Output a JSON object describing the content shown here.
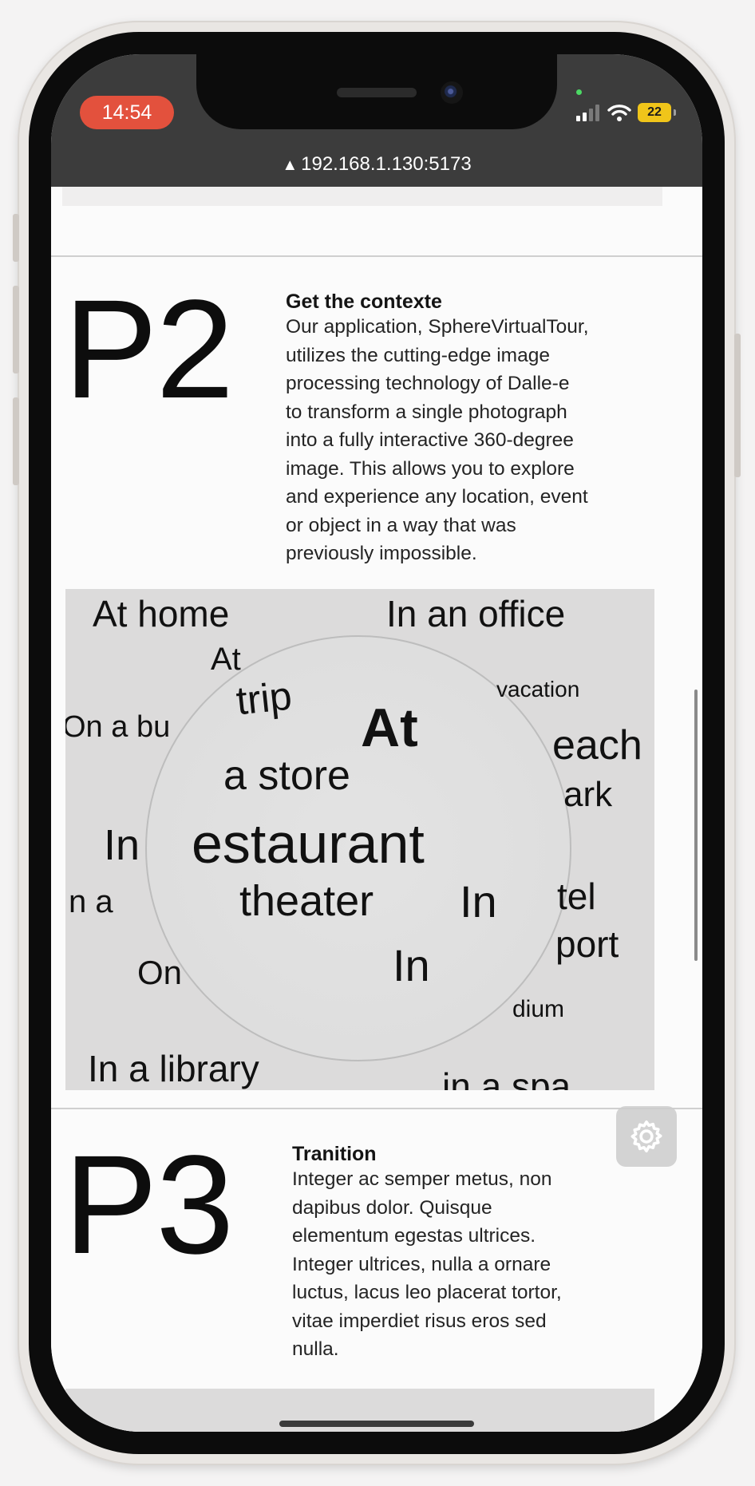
{
  "status_bar": {
    "time": "14:54",
    "battery": "22",
    "icons": [
      "signal-icon",
      "wifi-icon",
      "battery-icon"
    ]
  },
  "browser": {
    "url": "192.168.1.130:5173",
    "lock_icon": "▲"
  },
  "sections": [
    {
      "number": "P2",
      "title": "Get the contexte",
      "lines": [
        "Our application, SphereVirtualTour,",
        "utilizes the cutting-edge image",
        "processing technology of Dalle-e",
        "to transform a single photograph",
        "into a fully interactive 360-degree",
        "image. This allows you to explore",
        "and experience any location, event",
        "or object in a way that was",
        "previously impossible."
      ]
    },
    {
      "number": "P3",
      "title": "Tranition",
      "lines": [
        "Integer ac semper metus, non",
        "dapibus dolor. Quisque",
        "elementum egestas ultrices.",
        "Integer ultrices, nulla a ornare",
        "luctus, lacus leo placerat tortor,",
        "vitae imperdiet risus eros sed",
        "nulla."
      ]
    }
  ],
  "sphere_words": [
    "At home",
    "In an office",
    "At",
    "trip",
    "vacation",
    "On a bu",
    "At",
    "a store",
    "each",
    "ark",
    "In",
    "estaurant",
    "n a",
    "theater",
    "In",
    "tel",
    "port",
    "On",
    "In",
    "dium",
    "In a library",
    "in a spa"
  ],
  "floating_button": {
    "icon": "gear-icon"
  }
}
